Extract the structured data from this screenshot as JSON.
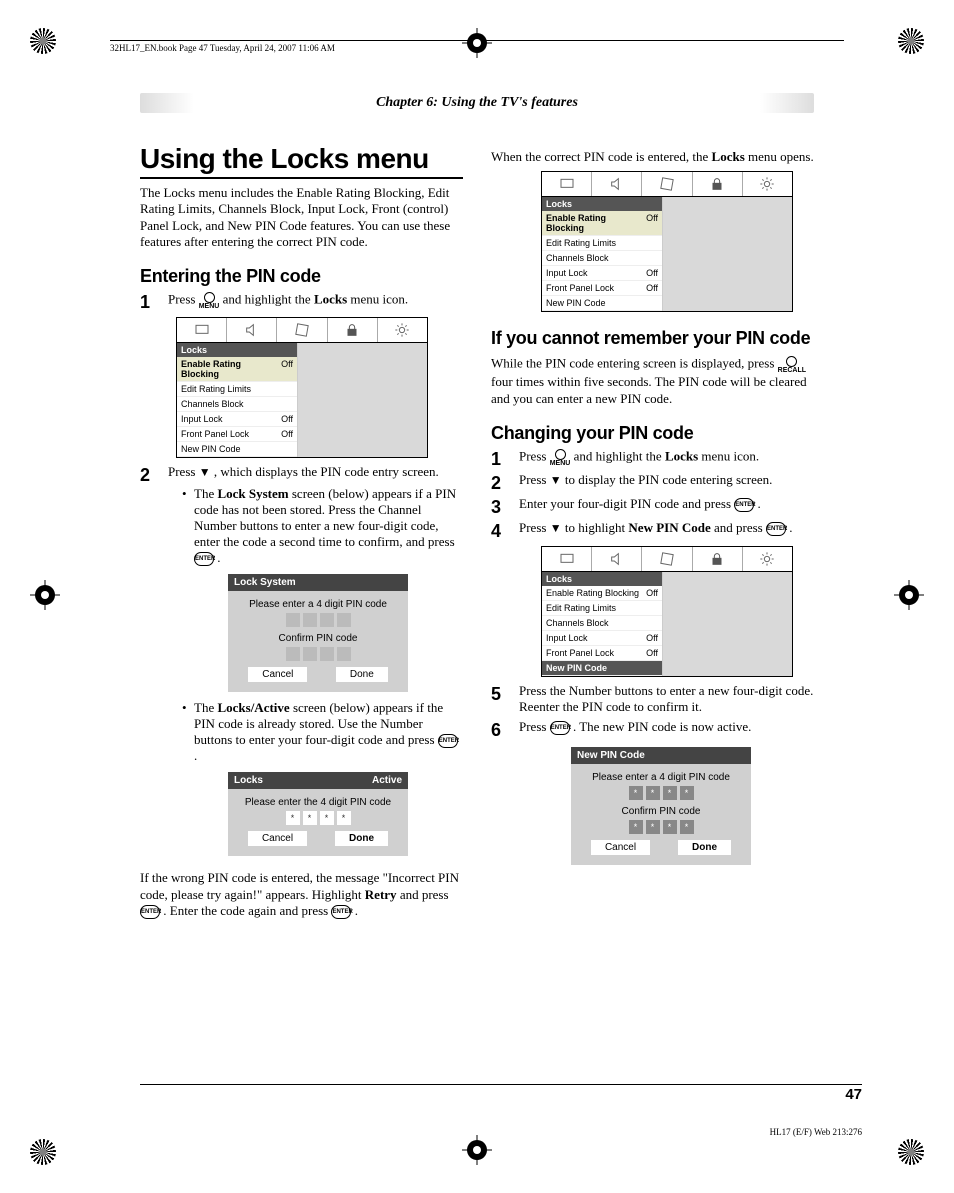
{
  "bookline": "32HL17_EN.book  Page 47  Tuesday, April 24, 2007  11:06 AM",
  "chapter": "Chapter 6: Using the TV's features",
  "page_number": "47",
  "footer_code": "HL17 (E/F) Web 213:276",
  "left": {
    "h1": "Using the Locks menu",
    "intro": "The Locks menu includes the Enable Rating Blocking, Edit Rating Limits, Channels Block, Input Lock, Front (control) Panel Lock, and New PIN Code features. You can use these features after entering the correct PIN code.",
    "h2a": "Entering the PIN code",
    "step1_a": "Press ",
    "step1_b": " and highlight the ",
    "step1_bold": "Locks",
    "step1_c": " menu icon.",
    "menubox": {
      "title": "Locks",
      "rows": [
        {
          "label": "Enable Rating Blocking",
          "val": "Off",
          "hl": true
        },
        {
          "label": "Edit Rating Limits",
          "val": ""
        },
        {
          "label": "Channels Block",
          "val": ""
        },
        {
          "label": "Input Lock",
          "val": "Off"
        },
        {
          "label": "Front Panel Lock",
          "val": "Off"
        },
        {
          "label": "New PIN Code",
          "val": ""
        }
      ]
    },
    "step2_a": "Press ",
    "step2_b": ", which displays the PIN code entry screen.",
    "bullet1_a": "The ",
    "bullet1_bold": "Lock System",
    "bullet1_b": " screen (below) appears if a PIN code has not been stored. Press the Channel Number buttons to enter a new four-digit code, enter the code a second time to confirm, and press ",
    "bullet1_c": ".",
    "dialog1": {
      "title": "Lock System",
      "line1": "Please enter a 4 digit PIN code",
      "line2": "Confirm PIN code",
      "btn_cancel": "Cancel",
      "btn_done": "Done"
    },
    "bullet2_a": "The ",
    "bullet2_bold": "Locks/Active",
    "bullet2_b": " screen (below) appears if the PIN code is already stored. Use the Number buttons to enter your four-digit code and press ",
    "bullet2_c": ".",
    "dialog2": {
      "title_left": "Locks",
      "title_right": "Active",
      "line1": "Please enter the 4 digit PIN code",
      "btn_cancel": "Cancel",
      "btn_done": "Done"
    },
    "wrongpin_a": "If the wrong PIN code is entered, the message \"Incorrect PIN code, please try again!\" appears. Highlight ",
    "wrongpin_bold": "Retry",
    "wrongpin_b": " and press ",
    "wrongpin_c": ". Enter the code again and press ",
    "wrongpin_d": "."
  },
  "right": {
    "top_a": "When the correct PIN code is entered, the ",
    "top_bold": "Locks",
    "top_b": " menu opens.",
    "menubox_top": {
      "title": "Locks",
      "rows": [
        {
          "label": "Enable Rating Blocking",
          "val": "Off",
          "hl": true
        },
        {
          "label": "Edit Rating Limits",
          "val": ""
        },
        {
          "label": "Channels Block",
          "val": ""
        },
        {
          "label": "Input Lock",
          "val": "Off"
        },
        {
          "label": "Front Panel Lock",
          "val": "Off"
        },
        {
          "label": "New PIN Code",
          "val": ""
        }
      ]
    },
    "h2a": "If you cannot remember your PIN code",
    "forget_a": "While the PIN code entering screen is displayed, press ",
    "forget_b": " four times within five seconds. The PIN code will be cleared and you can enter a new PIN code.",
    "h2b": "Changing your PIN code",
    "c_step1_a": "Press ",
    "c_step1_b": " and highlight the ",
    "c_step1_bold": "Locks",
    "c_step1_c": " menu icon.",
    "c_step2_a": "Press ",
    "c_step2_b": " to display the PIN code entering screen.",
    "c_step3_a": "Enter your four-digit PIN code and press ",
    "c_step3_b": ".",
    "c_step4_a": "Press ",
    "c_step4_b": " to highlight ",
    "c_step4_bold": "New PIN Code",
    "c_step4_c": " and press ",
    "c_step4_d": ".",
    "menubox_mid": {
      "title": "Locks",
      "rows": [
        {
          "label": "Enable Rating Blocking",
          "val": "Off"
        },
        {
          "label": "Edit Rating Limits",
          "val": ""
        },
        {
          "label": "Channels Block",
          "val": ""
        },
        {
          "label": "Input Lock",
          "val": "Off"
        },
        {
          "label": "Front Panel Lock",
          "val": "Off"
        },
        {
          "label": "New PIN Code",
          "val": "",
          "hlb": true
        }
      ]
    },
    "c_step5": "Press the Number buttons to enter a new four-digit code. Reenter the PIN code to confirm it.",
    "c_step6_a": "Press ",
    "c_step6_b": ". The new PIN code is now active.",
    "dialog3": {
      "title": "New PIN Code",
      "line1": "Please enter a 4 digit PIN code",
      "line2": "Confirm PIN code",
      "btn_cancel": "Cancel",
      "btn_done": "Done"
    }
  }
}
